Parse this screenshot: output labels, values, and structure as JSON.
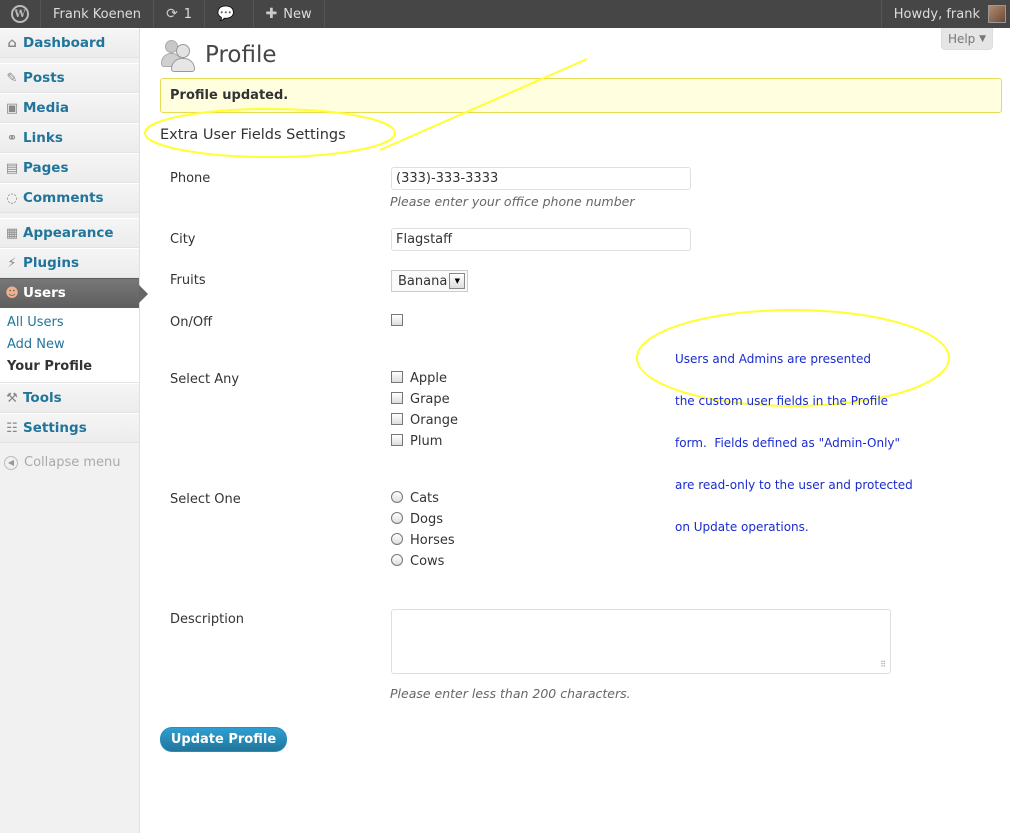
{
  "adminbar": {
    "site_name": "Frank Koenen",
    "updates_count": "1",
    "new_label": "New",
    "howdy": "Howdy, frank"
  },
  "sidebar": {
    "items": [
      {
        "label": "Dashboard",
        "icon": "dashboard-icon"
      },
      {
        "label": "Posts",
        "icon": "pushpin-icon"
      },
      {
        "label": "Media",
        "icon": "media-icon"
      },
      {
        "label": "Links",
        "icon": "link-icon"
      },
      {
        "label": "Pages",
        "icon": "pages-icon"
      },
      {
        "label": "Comments",
        "icon": "comment-icon"
      },
      {
        "label": "Appearance",
        "icon": "appearance-icon"
      },
      {
        "label": "Plugins",
        "icon": "plugin-icon"
      },
      {
        "label": "Users",
        "icon": "users-icon"
      },
      {
        "label": "Tools",
        "icon": "tools-icon"
      },
      {
        "label": "Settings",
        "icon": "settings-icon"
      }
    ],
    "users_submenu": [
      "All Users",
      "Add New",
      "Your Profile"
    ],
    "collapse_label": "Collapse menu"
  },
  "help_label": "Help",
  "page_title": "Profile",
  "notice": "Profile updated.",
  "section_title": "Extra User Fields Settings",
  "fields": {
    "phone": {
      "label": "Phone",
      "value": "(333)-333-3333",
      "description": "Please enter your office phone number"
    },
    "city": {
      "label": "City",
      "value": "Flagstaff"
    },
    "fruits": {
      "label": "Fruits",
      "selected": "Banana"
    },
    "onoff": {
      "label": "On/Off",
      "checked": false
    },
    "select_any": {
      "label": "Select Any",
      "options": [
        "Apple",
        "Grape",
        "Orange",
        "Plum"
      ]
    },
    "select_one": {
      "label": "Select One",
      "options": [
        "Cats",
        "Dogs",
        "Horses",
        "Cows"
      ]
    },
    "description": {
      "label": "Description",
      "value": "",
      "description": "Please enter less than 200 characters."
    }
  },
  "update_button": "Update Profile",
  "annotation": {
    "color": "#ffff33",
    "text_color": "#1a2bd0",
    "lines": [
      "Users and Admins are presented",
      "the custom user fields in the Profile",
      "form.  Fields defined as \"Admin-Only\"",
      "are read-only to the user and protected",
      "on Update operations."
    ]
  }
}
